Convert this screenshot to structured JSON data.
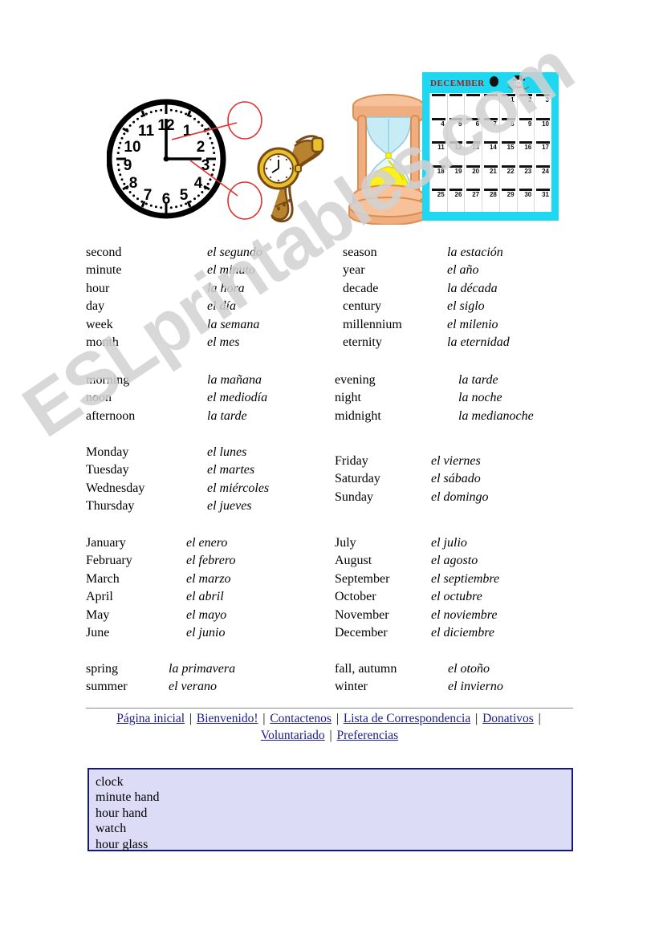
{
  "watermark": {
    "text": "ESLprintables.com"
  },
  "illustrations": {
    "clock": {
      "name": "analog-clock",
      "numerals": [
        "12",
        "1",
        "2",
        "3",
        "4",
        "5",
        "6",
        "7",
        "8",
        "9",
        "10",
        "11"
      ],
      "time_shown": "3:00",
      "callouts": [
        "minute hand",
        "hour hand"
      ],
      "callout_color": "#e03030"
    },
    "watch": {
      "name": "wrist-watch",
      "strap_color": "#a5702a",
      "case_color": "#e8c02c"
    },
    "hourglass": {
      "name": "hour-glass",
      "frame_color": "#f5b989",
      "glass_color": "#bfe9f2",
      "sand_color": "#fbf21a"
    },
    "calendar": {
      "name": "december-calendar",
      "month_label": "DECEMBER",
      "month_label_color": "#a02020",
      "background_color": "#1ed7f0",
      "weeks": [
        [
          "",
          "",
          "",
          "",
          "1",
          "2",
          "3"
        ],
        [
          "4",
          "5",
          "6",
          "7",
          "8",
          "9",
          "10"
        ],
        [
          "11",
          "12",
          "13",
          "14",
          "15",
          "16",
          "17"
        ],
        [
          "18",
          "19",
          "20",
          "21",
          "22",
          "23",
          "24"
        ],
        [
          "25",
          "26",
          "27",
          "28",
          "29",
          "30",
          "31"
        ]
      ]
    }
  },
  "vocabulary": {
    "time_units": {
      "english": [
        "second",
        "minute",
        "hour",
        "day",
        "week",
        "month"
      ],
      "spanish": [
        "el segundo",
        "el minuto",
        "la hora",
        "el día",
        "la semana",
        "el mes"
      ]
    },
    "time_periods": {
      "english": [
        "season",
        "year",
        "decade",
        "century",
        "millennium",
        "eternity"
      ],
      "spanish": [
        "la estación",
        "el año",
        "la década",
        "el siglo",
        "el milenio",
        "la eternidad"
      ]
    },
    "day_parts_left": {
      "english": [
        "morning",
        "noon",
        "afternoon"
      ],
      "spanish": [
        "la mañana",
        "el mediodía",
        "la tarde"
      ]
    },
    "day_parts_right": {
      "english": [
        "evening",
        "night",
        "midnight"
      ],
      "spanish": [
        "la tarde",
        "la noche",
        "la medianoche"
      ]
    },
    "weekdays_left": {
      "english": [
        "Monday",
        "Tuesday",
        "Wednesday",
        "Thursday"
      ],
      "spanish": [
        "el lunes",
        "el martes",
        "el miércoles",
        "el jueves"
      ]
    },
    "weekdays_right": {
      "english": [
        "Friday",
        "Saturday",
        "Sunday"
      ],
      "spanish": [
        "el viernes",
        "el sábado",
        "el domingo"
      ]
    },
    "months_left": {
      "english": [
        "January",
        "February",
        "March",
        "April",
        "May",
        "June"
      ],
      "spanish": [
        "el enero",
        "el febrero",
        "el marzo",
        "el abril",
        "el mayo",
        "el junio"
      ]
    },
    "months_right": {
      "english": [
        "July",
        "August",
        "September",
        "October",
        "November",
        "December"
      ],
      "spanish": [
        "el julio",
        "el agosto",
        "el septiembre",
        "el octubre",
        "el noviembre",
        "el diciembre"
      ]
    },
    "seasons_left": {
      "english": [
        "spring",
        "summer"
      ],
      "spanish": [
        "la primavera",
        "el verano"
      ]
    },
    "seasons_right": {
      "english": [
        "fall, autumn",
        "winter"
      ],
      "spanish": [
        "el otoño",
        "el invierno"
      ]
    }
  },
  "footer": {
    "links": [
      "Página inicial",
      "Bienvenido!",
      "Contactenos",
      "Lista de Correspondencia",
      "Donativos",
      "Voluntariado",
      "Preferencias"
    ],
    "separator": "|",
    "link_color": "#1c1c8c"
  },
  "word_box": {
    "items": [
      "clock",
      "minute hand",
      "hour hand",
      "watch",
      "hour glass"
    ],
    "background_color": "#dcdcf7",
    "border_color": "#18187a"
  }
}
